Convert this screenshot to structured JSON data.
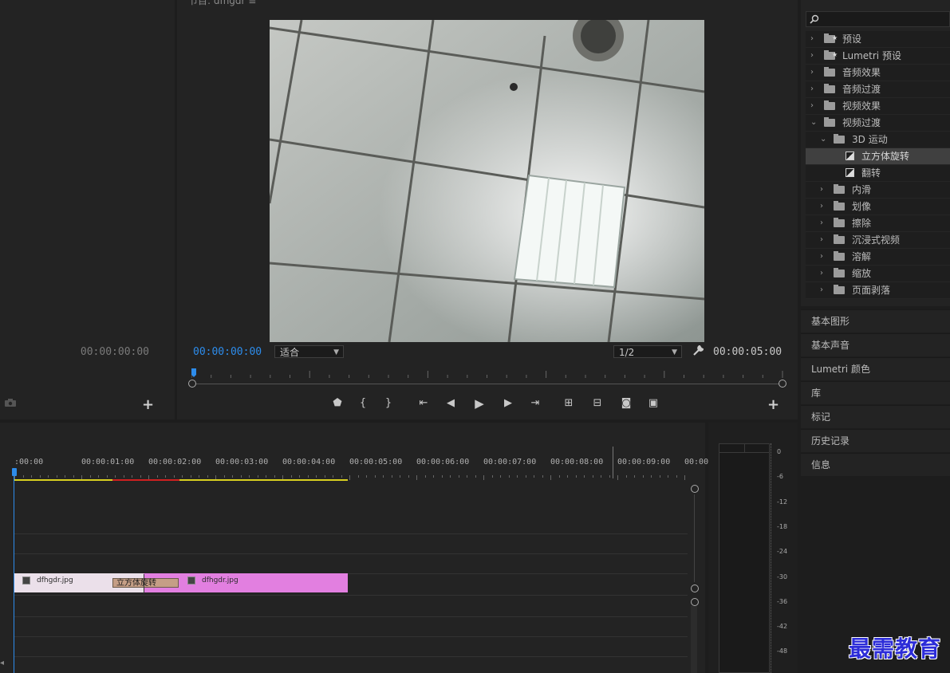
{
  "source_panel": {
    "timecode": "00:00:00:00"
  },
  "program": {
    "title": "节目: dfhgdr ≡",
    "timecode_current": "00:00:00:00",
    "zoom": "适合",
    "resolution": "1/2",
    "timecode_duration": "00:00:05:00"
  },
  "effects": {
    "items": [
      {
        "label": "预设",
        "level": 0,
        "kind": "preset-folder",
        "expanded": false
      },
      {
        "label": "Lumetri 预设",
        "level": 0,
        "kind": "preset-folder",
        "expanded": false
      },
      {
        "label": "音频效果",
        "level": 0,
        "kind": "folder",
        "expanded": false
      },
      {
        "label": "音频过渡",
        "level": 0,
        "kind": "folder",
        "expanded": false
      },
      {
        "label": "视频效果",
        "level": 0,
        "kind": "folder",
        "expanded": false
      },
      {
        "label": "视频过渡",
        "level": 0,
        "kind": "folder",
        "expanded": true
      },
      {
        "label": "3D 运动",
        "level": 1,
        "kind": "folder",
        "expanded": true
      },
      {
        "label": "立方体旋转",
        "level": 2,
        "kind": "effect",
        "selected": true
      },
      {
        "label": "翻转",
        "level": 2,
        "kind": "effect"
      },
      {
        "label": "内滑",
        "level": 1,
        "kind": "folder",
        "expanded": false
      },
      {
        "label": "划像",
        "level": 1,
        "kind": "folder",
        "expanded": false
      },
      {
        "label": "擦除",
        "level": 1,
        "kind": "folder",
        "expanded": false
      },
      {
        "label": "沉浸式视频",
        "level": 1,
        "kind": "folder",
        "expanded": false
      },
      {
        "label": "溶解",
        "level": 1,
        "kind": "folder",
        "expanded": false
      },
      {
        "label": "缩放",
        "level": 1,
        "kind": "folder",
        "expanded": false
      },
      {
        "label": "页面剥落",
        "level": 1,
        "kind": "folder",
        "expanded": false
      }
    ]
  },
  "side_panels": [
    "基本图形",
    "基本声音",
    "Lumetri 颜色",
    "库",
    "标记",
    "历史记录",
    "信息"
  ],
  "timeline": {
    "ruler_labels": [
      ":00:00",
      "00:00:01:00",
      "00:00:02:00",
      "00:00:03:00",
      "00:00:04:00",
      "00:00:05:00",
      "00:00:06:00",
      "00:00:07:00",
      "00:00:08:00",
      "00:00:09:00",
      "00:00:"
    ],
    "clip1_name": "dfhgdr.jpg",
    "clip2_name": "dfhgdr.jpg",
    "transition_name": "立方体旋转"
  },
  "meter": {
    "labels": [
      "0",
      "-6",
      "-12",
      "-18",
      "-24",
      "-30",
      "-36",
      "-42",
      "-48"
    ]
  },
  "watermark": "最需教育",
  "colors": {
    "accent": "#2d8ceb",
    "clip": "#e27fe0",
    "transition": "#c59e86",
    "render_yellow": "#d8d020",
    "render_red": "#d02020"
  }
}
